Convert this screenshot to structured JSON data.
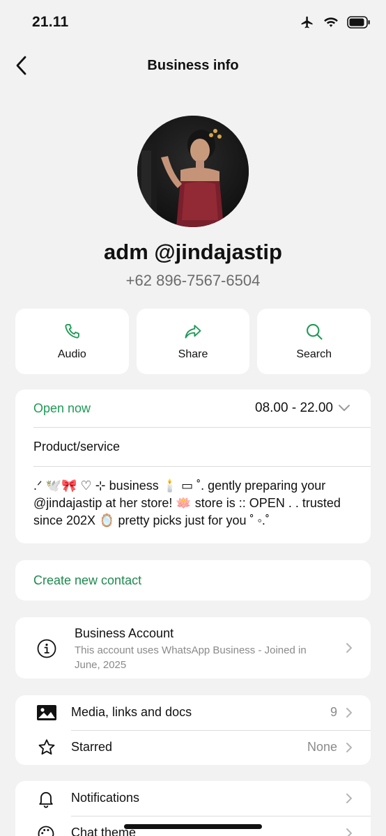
{
  "status_bar": {
    "time": "21.11"
  },
  "nav": {
    "title": "Business info"
  },
  "profile": {
    "name": "adm @jindajastip",
    "phone": "+62 896-7567-6504"
  },
  "actions": [
    {
      "label": "Audio",
      "icon": "phone-icon"
    },
    {
      "label": "Share",
      "icon": "share-arrow-icon"
    },
    {
      "label": "Search",
      "icon": "search-icon"
    }
  ],
  "hours": {
    "status": "Open now",
    "range": "08.00 - 22.00"
  },
  "category": "Product/service",
  "bio": ".ᐟ 🕊️🎀 ♡ ⊹ business 🕯️ ▭ ˚. gently preparing your @jindajastip at her store! 🪷 store is :: OPEN . . trusted since 202X 🪞 pretty picks just for you ˚ ◦.˚",
  "create_contact": "Create new contact",
  "business_account": {
    "title": "Business Account",
    "description": "This account uses WhatsApp Business - Joined in June, 2025"
  },
  "media": {
    "media_label": "Media, links and docs",
    "media_count": "9",
    "starred_label": "Starred",
    "starred_value": "None"
  },
  "settings": {
    "notifications_label": "Notifications",
    "chat_theme_label": "Chat theme"
  },
  "colors": {
    "accent_green": "#1e9a56",
    "background": "#f2f2f2",
    "card": "#ffffff"
  }
}
